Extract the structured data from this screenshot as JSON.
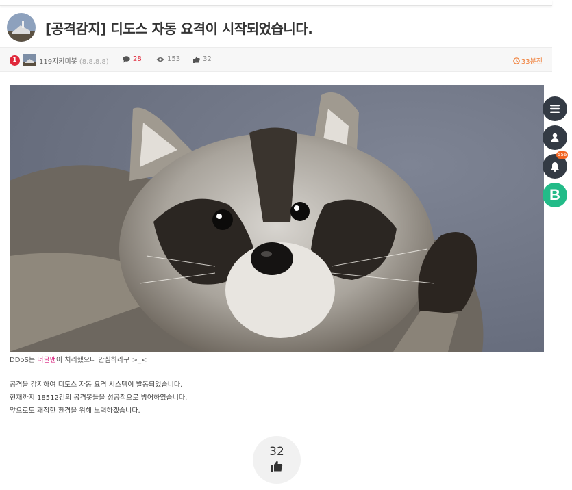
{
  "post": {
    "title": "[공격감지] 디도스 자동 요격이 시작되었습니다."
  },
  "meta": {
    "level": "1",
    "author": "119지키미봇",
    "author_ip": "(8.8.8.8)",
    "comments": "28",
    "views": "153",
    "likes": "32",
    "time": "33분전"
  },
  "content": {
    "caption_prefix": "DDoS는 ",
    "caption_highlight": "너굴맨",
    "caption_suffix": "이 처리했으니 안심하라구 >_<",
    "lines": [
      "공격을 감지하여 디도스 자동 요격 시스템이 발동되었습니다.",
      "현재까지 18512건의 공격봇들을 성공적으로 방어하였습니다.",
      "앞으로도 쾌적한 환경을 위해 노력하겠습니다."
    ]
  },
  "like_button": {
    "count": "32"
  },
  "sidebar": {
    "notification_count": "556",
    "brand_letter": "B"
  },
  "icons": [
    "menu-icon",
    "user-icon",
    "bell-icon",
    "comment-icon",
    "eye-icon",
    "thumbs-up-icon",
    "clock-icon"
  ],
  "colors": {
    "accent_red": "#e0283b",
    "time_orange": "#f0813c",
    "brand_green": "#22bb88",
    "highlight_pink": "#d6197a"
  }
}
